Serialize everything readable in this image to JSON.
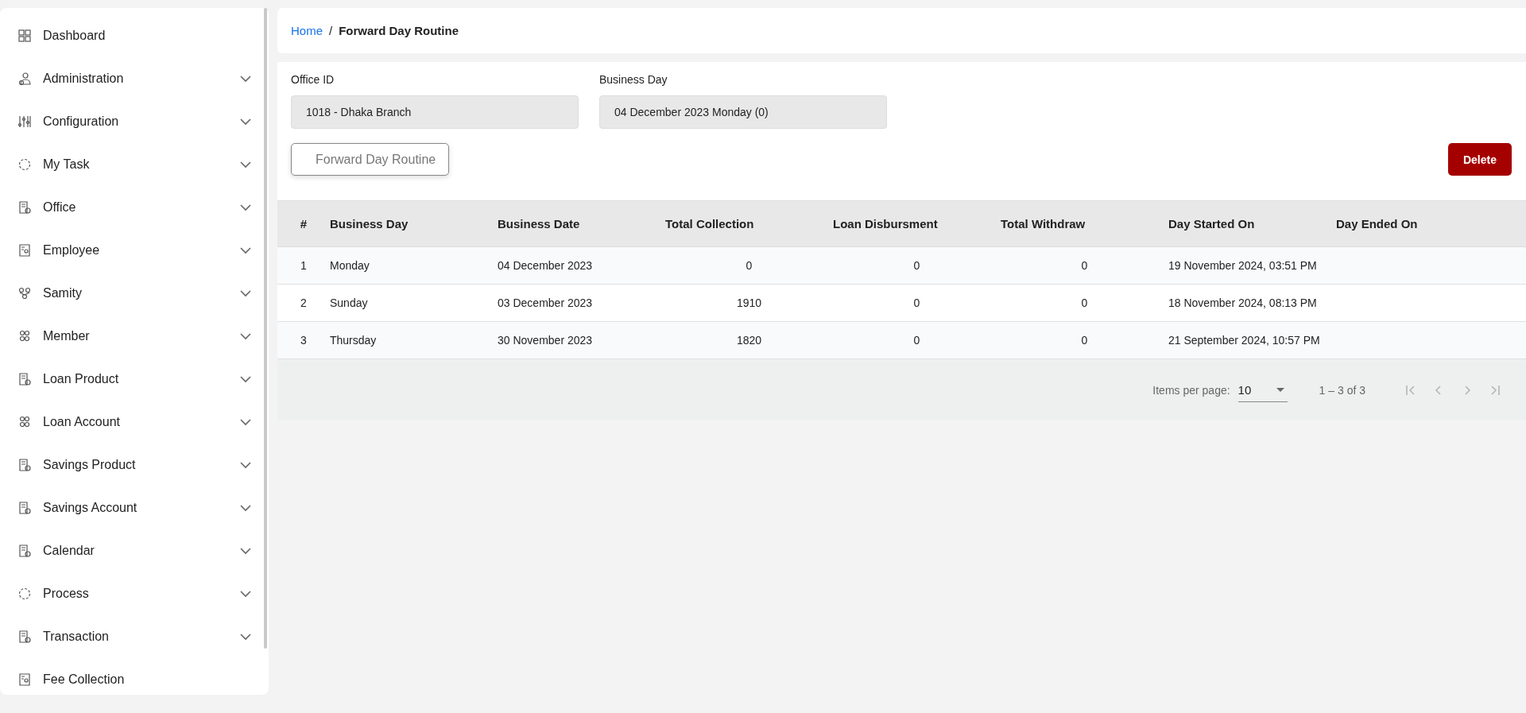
{
  "sidebar": {
    "items": [
      {
        "label": "Dashboard",
        "has_submenu": false,
        "selected": false
      },
      {
        "label": "Administration",
        "has_submenu": true,
        "selected": false
      },
      {
        "label": "Configuration",
        "has_submenu": true,
        "selected": false
      },
      {
        "label": "My Task",
        "has_submenu": true,
        "selected": false
      },
      {
        "label": "Office",
        "has_submenu": true,
        "selected": false
      },
      {
        "label": "Employee",
        "has_submenu": true,
        "selected": false
      },
      {
        "label": "Samity",
        "has_submenu": true,
        "selected": false
      },
      {
        "label": "Member",
        "has_submenu": true,
        "selected": false
      },
      {
        "label": "Loan Product",
        "has_submenu": true,
        "selected": false
      },
      {
        "label": "Loan Account",
        "has_submenu": true,
        "selected": false
      },
      {
        "label": "Savings Product",
        "has_submenu": true,
        "selected": false
      },
      {
        "label": "Savings Account",
        "has_submenu": true,
        "selected": false
      },
      {
        "label": "Calendar",
        "has_submenu": true,
        "selected": false
      },
      {
        "label": "Process",
        "has_submenu": true,
        "selected": false
      },
      {
        "label": "Transaction",
        "has_submenu": true,
        "selected": false
      },
      {
        "label": "Fee Collection",
        "has_submenu": false,
        "selected": false
      }
    ]
  },
  "breadcrumb": {
    "link": "Home",
    "separator": "/",
    "current": "Forward Day Routine"
  },
  "form": {
    "fields": [
      {
        "label": "Office ID",
        "value": "1018 - Dhaka Branch",
        "disabled": true
      },
      {
        "label": "Business Day",
        "value": "04 December 2023 Monday (0)",
        "disabled": true
      }
    ],
    "buttons": [
      {
        "label": "Forward Day Routine",
        "kind": "outline",
        "disabled": true
      },
      {
        "label": "Delete",
        "kind": "danger",
        "disabled": false
      }
    ]
  },
  "table": {
    "columns": [
      "#",
      "Business Day",
      "Business Date",
      "Total Collection",
      "Loan Disbursment",
      "Total Withdraw",
      "Day Started On",
      "Day Ended On"
    ],
    "rows": [
      [
        "1",
        "Monday",
        "04 December 2023",
        "0",
        "0",
        "0",
        "19 November 2024, 03:51 PM",
        ""
      ],
      [
        "2",
        "Sunday",
        "03 December 2023",
        "1910",
        "0",
        "0",
        "18 November 2024, 08:13 PM",
        ""
      ],
      [
        "3",
        "Thursday",
        "30 November 2023",
        "1820",
        "0",
        "0",
        "21 September 2024, 10:57 PM",
        ""
      ]
    ]
  },
  "paginator": {
    "items_per_page_label": "Items per page:",
    "page_size": "10",
    "range": "1 – 3 of 3",
    "first_disabled": true,
    "previous_disabled": true,
    "next_disabled": true,
    "last_disabled": true
  }
}
